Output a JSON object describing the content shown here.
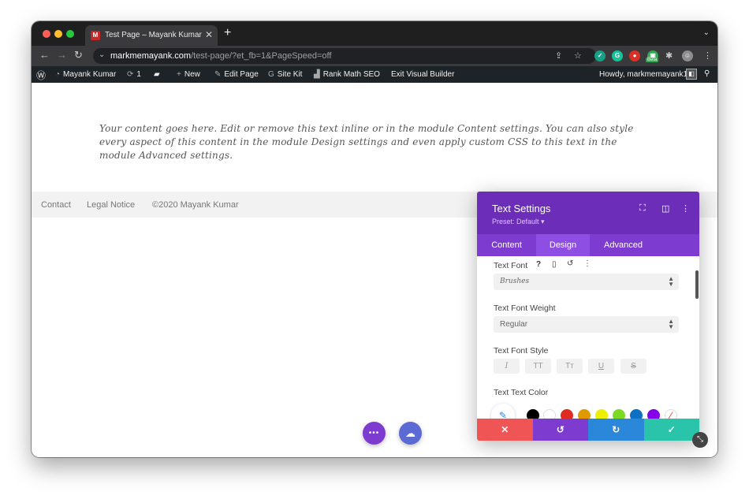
{
  "browser": {
    "tab_title": "Test Page – Mayank Kumar",
    "tab_favicon": "M",
    "url_domain": "markmemayank.com",
    "url_path": "/test-page/?et_fb=1&PageSpeed=off",
    "beta_badge": "Beta",
    "colors": {
      "close": "#ff5f57",
      "minimize": "#febc2e",
      "maximize": "#28c840"
    }
  },
  "admin_bar": {
    "site_name": "Mayank Kumar",
    "updates_count": "1",
    "new_label": "New",
    "edit_page_label": "Edit Page",
    "site_kit_label": "Site Kit",
    "rank_math_label": "Rank Math SEO",
    "exit_builder_label": "Exit Visual Builder",
    "howdy": "Howdy, markmemayank1"
  },
  "page": {
    "body_text": "Your content goes here. Edit or remove this text inline or in the module Content settings. You can also style every aspect of this content in the module Design settings and even apply custom CSS to this text in the module Advanced settings.",
    "footer_links": [
      "Contact",
      "Legal Notice",
      "©2020 Mayank Kumar"
    ]
  },
  "settings": {
    "title": "Text Settings",
    "preset": "Preset: Default ▾",
    "tabs": [
      "Content",
      "Design",
      "Advanced"
    ],
    "active_tab": "Design",
    "text_font_label": "Text Font",
    "text_font_value": "Brushes",
    "font_weight_label": "Text Font Weight",
    "font_weight_value": "Regular",
    "font_style_label": "Text Font Style",
    "font_style_options": [
      "I",
      "TT",
      "Tт",
      "U",
      "S"
    ],
    "text_color_label": "Text Text Color",
    "swatches": [
      "#000000",
      "#ffffff",
      "#e02b20",
      "#e09900",
      "#edf000",
      "#7cda24",
      "#0c71c3",
      "#8300e9"
    ],
    "footer_buttons": {
      "cancel": "✕",
      "undo": "↺",
      "redo": "↻",
      "save": "✓"
    },
    "colors": {
      "header": "#6c2eb9",
      "cancel": "#ef5555",
      "undo": "#7e3bd0",
      "redo": "#2b87da",
      "save": "#29c4a9"
    }
  },
  "builder": {
    "more_button": "•••",
    "fab_colors": {
      "more": "#7e3bd0",
      "builder": "#5c6bd4"
    }
  }
}
